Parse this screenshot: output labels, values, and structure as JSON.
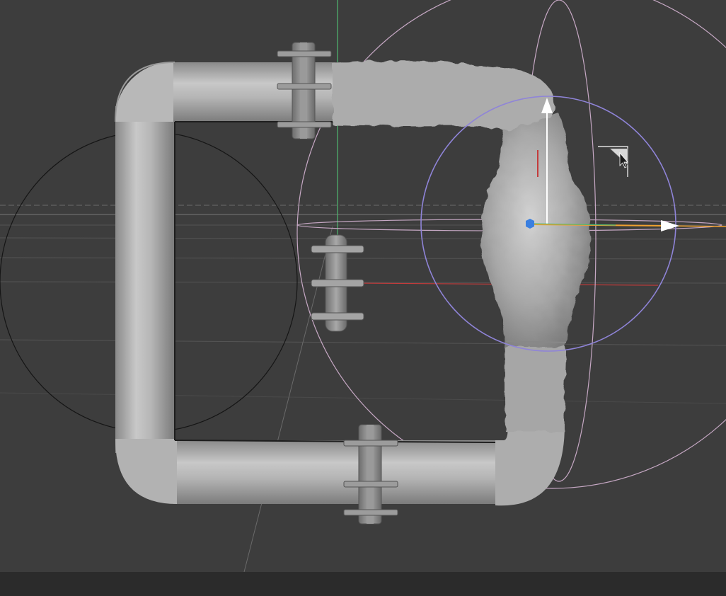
{
  "viewport": {
    "background": "#3d3d3d",
    "grid_color": "#5a5a5a",
    "horizon_color": "#6e6e6e",
    "world_axes": {
      "x_color": "#c43b3b",
      "y_color": "#4fb870",
      "z_color": "#3a6fd6"
    }
  },
  "scene": {
    "object": "pipe-loop",
    "pipe_color": "#b4b4b4",
    "deformed_segment_color": "#aaaaaa",
    "flange_color": "#8e8e8e",
    "flanges": [
      "flange-top",
      "flange-middle",
      "flange-bottom"
    ]
  },
  "gizmo": {
    "type": "move",
    "axis_colors": {
      "x": "#f0a030",
      "y": "#ffffff",
      "z": "#3a7fe0"
    },
    "falloff_sphere_color": "#8f84d8",
    "outer_sphere_color": "#c6a8c4"
  },
  "cursor": {
    "icon": "arrow-cursor-icon"
  },
  "status_bar": {
    "background": "#2b2b2b"
  }
}
